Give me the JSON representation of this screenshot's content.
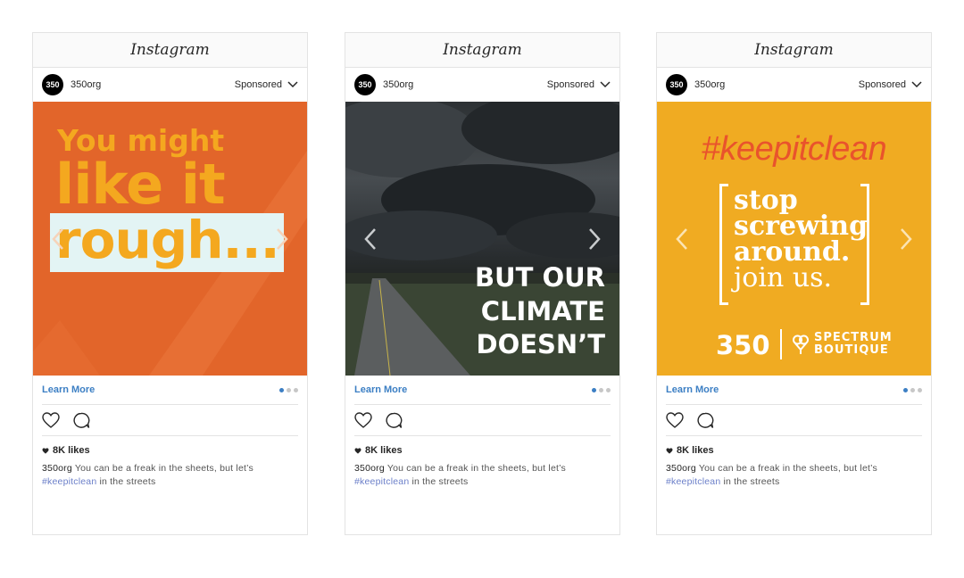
{
  "brand": "Instagram",
  "cards": [
    {
      "avatar": "350",
      "username": "350org",
      "sponsored": "Sponsored",
      "media": {
        "line1": "You might",
        "line2": "like it",
        "line3": "rough..."
      },
      "learn_more": "Learn More",
      "likes": "8K likes",
      "caption_user": "350org",
      "caption_text": " You can be a freak in the sheets, but let’s",
      "caption_tag": "#keepitclean",
      "caption_tail": " in the streets",
      "active_dot": 0
    },
    {
      "avatar": "350",
      "username": "350org",
      "sponsored": "Sponsored",
      "media": {
        "line1": "BUT OUR",
        "line2": "CLIMATE",
        "line3": "DOESN’T"
      },
      "learn_more": "Learn More",
      "likes": "8K likes",
      "caption_user": "350org",
      "caption_text": " You can be a freak in the sheets, but let’s",
      "caption_tag": "#keepitclean",
      "caption_tail": " in the streets",
      "active_dot": 0
    },
    {
      "avatar": "350",
      "username": "350org",
      "sponsored": "Sponsored",
      "media": {
        "hashtag": "#keepitclean",
        "box_line1": "stop",
        "box_line2": "screwing",
        "box_line3": "around.",
        "box_line4": "join us.",
        "logo": "350",
        "partner_line1": "SPECTRUM",
        "partner_line2": "BOUTIQUE"
      },
      "learn_more": "Learn More",
      "likes": "8K likes",
      "caption_user": "350org",
      "caption_text": " You can be a freak in the sheets, but let’s",
      "caption_tag": "#keepitclean",
      "caption_tail": " in the streets",
      "active_dot": 0
    }
  ],
  "colors": {
    "link_blue": "#3c7fc4",
    "card1_bg": "#e2652a",
    "card1_text": "#f4a81f",
    "card3_bg": "#f0ab22",
    "card3_hashtag": "#e9532c"
  },
  "icons": [
    "chevron-down-icon",
    "heart-icon",
    "comment-icon",
    "arrow-left-icon",
    "arrow-right-icon"
  ]
}
